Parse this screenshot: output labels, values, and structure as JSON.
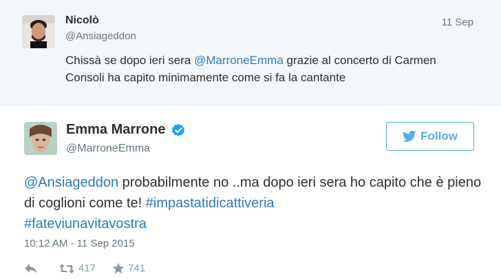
{
  "parent_tweet": {
    "name": "Nicolò",
    "handle": "@Ansiageddon",
    "time": "11 Sep",
    "text_before": "Chissà se dopo ieri sera ",
    "mention": "@MarroneEmma",
    "text_after": " grazie al concerto di Carmen Consoli ha capito minimamente come si fa la cantante"
  },
  "tweet": {
    "name": "Emma Marrone",
    "verified_icon": "verified-badge-icon",
    "handle": "@MarroneEmma",
    "follow_label": "Follow",
    "mention": "@Ansiageddon",
    "text_mid": " probabilmente no ..ma dopo ieri sera ho capito che è pieno di coglioni come te! ",
    "hashtag1": "#impastatidicattiveria",
    "hashtag2": "#fateviunavitavostra",
    "timestamp": "10:12 AM - 11 Sep 2015",
    "retweets": "417",
    "likes": "741"
  },
  "colors": {
    "link": "#2b7bb9",
    "follow_accent": "#55acee",
    "verified": "#1da1f2",
    "parent_bg": "#f5f8fa",
    "muted": "#66757f"
  }
}
